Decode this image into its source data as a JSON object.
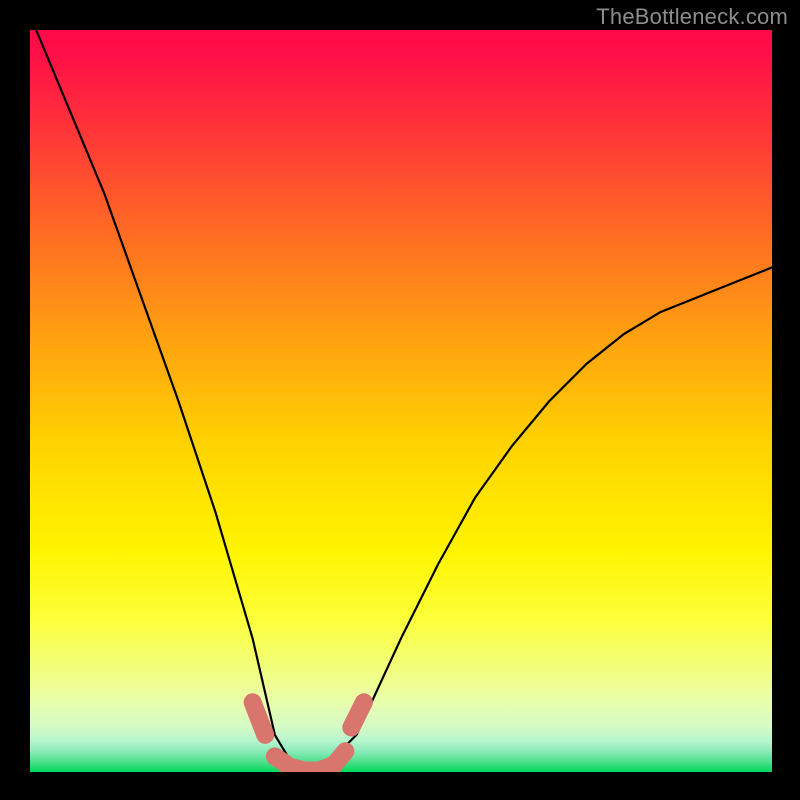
{
  "watermark": "TheBottleneck.com",
  "chart_data": {
    "type": "line",
    "title": "",
    "xlabel": "",
    "ylabel": "",
    "xlim": [
      0,
      1
    ],
    "ylim": [
      0,
      1
    ],
    "x": [
      0.0,
      0.05,
      0.1,
      0.15,
      0.2,
      0.25,
      0.3,
      0.33,
      0.36,
      0.39,
      0.44,
      0.5,
      0.55,
      0.6,
      0.65,
      0.7,
      0.75,
      0.8,
      0.85,
      0.9,
      0.95,
      1.0
    ],
    "values": [
      1.02,
      0.9,
      0.78,
      0.64,
      0.5,
      0.35,
      0.18,
      0.05,
      0.0,
      0.0,
      0.05,
      0.18,
      0.28,
      0.37,
      0.44,
      0.5,
      0.55,
      0.59,
      0.62,
      0.64,
      0.66,
      0.68
    ],
    "marker_segments": [
      {
        "x": [
          0.3,
          0.317
        ],
        "y": [
          0.094,
          0.05
        ]
      },
      {
        "x": [
          0.433,
          0.45
        ],
        "y": [
          0.06,
          0.094
        ]
      },
      {
        "x": [
          0.33,
          0.35,
          0.37,
          0.39,
          0.41,
          0.425
        ],
        "y": [
          0.021,
          0.007,
          0.002,
          0.002,
          0.01,
          0.028
        ]
      }
    ],
    "gradient_stops": [
      {
        "pos": 0.0,
        "color": "#ff0a47"
      },
      {
        "pos": 0.03,
        "color": "#ff0e47"
      },
      {
        "pos": 0.12,
        "color": "#ff2f3b"
      },
      {
        "pos": 0.27,
        "color": "#ff6a24"
      },
      {
        "pos": 0.42,
        "color": "#ffa310"
      },
      {
        "pos": 0.56,
        "color": "#ffd300"
      },
      {
        "pos": 0.7,
        "color": "#fff400"
      },
      {
        "pos": 0.79,
        "color": "#fdff37"
      },
      {
        "pos": 0.86,
        "color": "#f2ff7c"
      },
      {
        "pos": 0.905,
        "color": "#e9feac"
      },
      {
        "pos": 0.938,
        "color": "#d6fbc6"
      },
      {
        "pos": 0.958,
        "color": "#b6f6cd"
      },
      {
        "pos": 0.972,
        "color": "#8bebb9"
      },
      {
        "pos": 0.986,
        "color": "#4fe08d"
      },
      {
        "pos": 1.0,
        "color": "#00d858"
      }
    ]
  }
}
